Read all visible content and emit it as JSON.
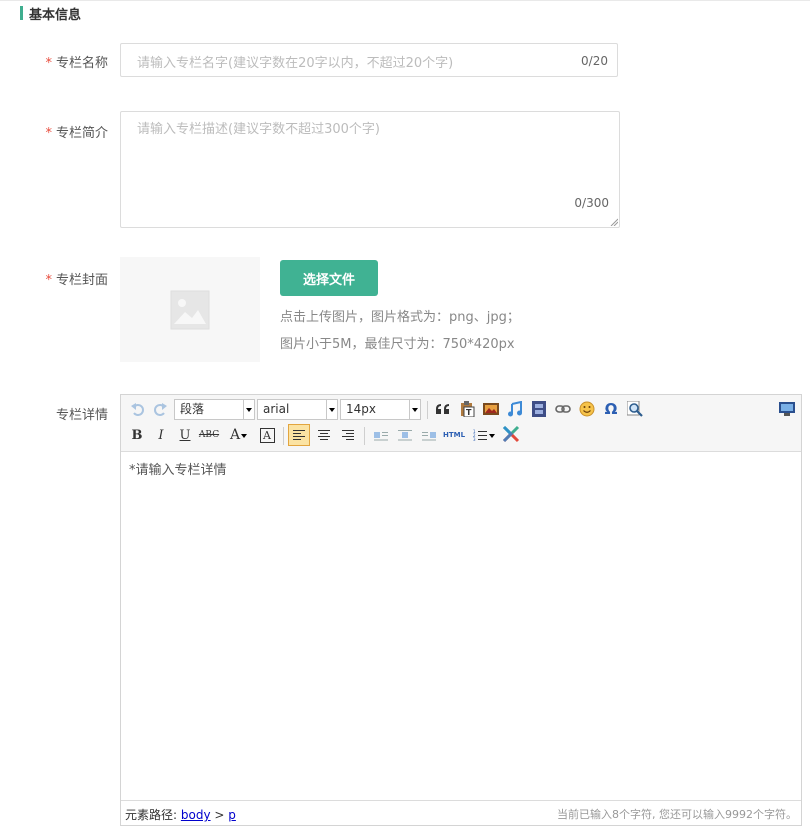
{
  "section": {
    "title": "基本信息"
  },
  "form": {
    "required_mark": "*",
    "name": {
      "label": "专栏名称",
      "placeholder": "请输入专栏名字(建议字数在20字以内，不超过20个字)",
      "counter": "0/20"
    },
    "intro": {
      "label": "专栏简介",
      "placeholder": "请输入专栏描述(建议字数不超过300个字)",
      "counter": "0/300"
    },
    "cover": {
      "label": "专栏封面",
      "button": "选择文件",
      "hint_line1": "点击上传图片，图片格式为：png、jpg；",
      "hint_line2": "图片小于5M，最佳尺寸为：750*420px"
    },
    "detail": {
      "label": "专栏详情"
    }
  },
  "editor": {
    "paragraph_select": "段落",
    "font_select": "arial",
    "size_select": "14px",
    "bold": "B",
    "italic": "I",
    "underline": "U",
    "strikethrough": "ABC",
    "font_color": "A",
    "bg_color": "A",
    "html": "HTML",
    "content": "*请输入专栏详情",
    "path_label": "元素路径:",
    "path_body": "body",
    "path_sep": ">",
    "path_p": "p",
    "word_count": "当前已输入8个字符, 您还可以输入9992个字符。"
  },
  "colors": {
    "accent": "#40b293",
    "required": "#e84c3d"
  }
}
